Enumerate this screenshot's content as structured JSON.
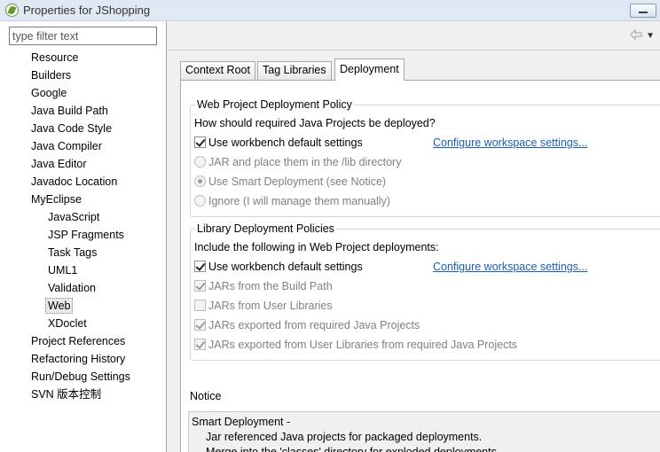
{
  "window": {
    "title": "Properties for JShopping"
  },
  "filter": {
    "placeholder": "type filter text"
  },
  "tree": [
    "Resource",
    "Builders",
    "Google",
    "Java Build Path",
    "Java Code Style",
    "Java Compiler",
    "Java Editor",
    "Javadoc Location",
    "MyEclipse",
    "JavaScript",
    "JSP Fragments",
    "Task Tags",
    "UML1",
    "Validation",
    "Web",
    "XDoclet",
    "Project References",
    "Refactoring History",
    "Run/Debug Settings",
    "SVN 版本控制"
  ],
  "selected_item": "Web",
  "tabs": [
    "Context Root",
    "Tag Libraries",
    "Deployment"
  ],
  "active_tab": "Deployment",
  "deployment_policy": {
    "title": "Web Project Deployment Policy",
    "question": "How should required Java Projects be deployed?",
    "use_defaults": "Use workbench default settings",
    "configure_link": "Configure workspace settings...",
    "options": [
      "JAR and place them in the /lib directory",
      "Use Smart Deployment (see Notice)",
      "Ignore  (I will manage them manually)"
    ]
  },
  "library_policies": {
    "title": "Library Deployment Policies",
    "intro": "Include the following in Web Project deployments:",
    "use_defaults": "Use workbench default settings",
    "configure_link": "Configure workspace settings...",
    "options": [
      "JARs from the Build Path",
      "JARs from User Libraries",
      "JARs exported from required Java Projects",
      "JARs exported from User Libraries from required Java Projects"
    ]
  },
  "notice": {
    "label": "Notice",
    "heading": "Smart Deployment -",
    "line1": "Jar referenced Java projects for packaged deployments.",
    "line2": "Merge into the 'classes' directory for exploded deployments."
  },
  "colors": {
    "link": "#1a5fb4",
    "disabled_text": "#808080",
    "selection": "#e8e8e8"
  }
}
